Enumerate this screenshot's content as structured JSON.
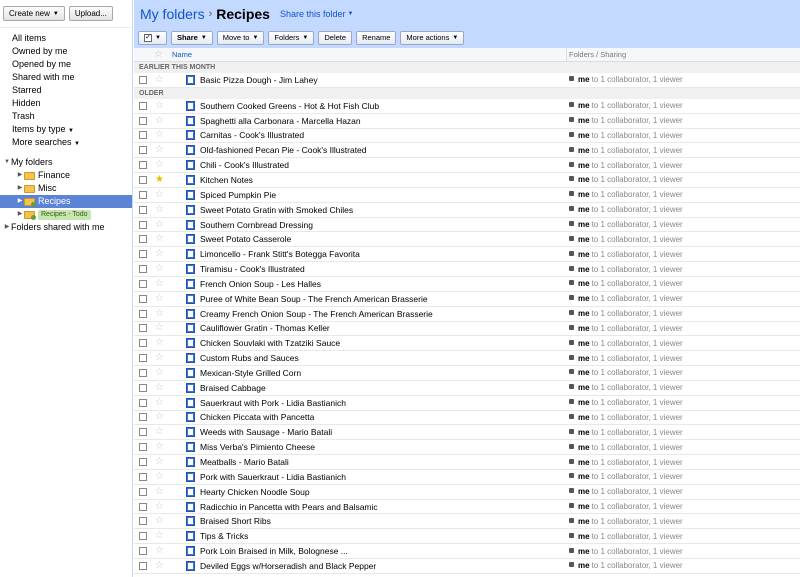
{
  "left": {
    "create_new": "Create new",
    "upload": "Upload...",
    "nav": [
      "All items",
      "Owned by me",
      "Opened by me",
      "Shared with me",
      "Starred",
      "Hidden",
      "Trash",
      "Items by type",
      "More searches"
    ],
    "my_folders": "My folders",
    "folders": [
      {
        "label": "Finance"
      },
      {
        "label": "Misc"
      },
      {
        "label": "Recipes"
      },
      {
        "label": "Recipes - Todo"
      }
    ],
    "shared_folders": "Folders shared with me"
  },
  "header": {
    "root": "My folders",
    "sep": "›",
    "current": "Recipes",
    "share_folder": "Share this folder"
  },
  "toolbar": {
    "share": "Share",
    "move_to": "Move to",
    "folders": "Folders",
    "delete": "Delete",
    "rename": "Rename",
    "more_actions": "More actions"
  },
  "columns": {
    "name": "Name",
    "folders_sharing": "Folders / Sharing"
  },
  "groups": {
    "earlier": "EARLIER THIS MONTH",
    "older": "OLDER"
  },
  "sharing": {
    "owner": "me",
    "rest": "to 1 collaborator, 1 viewer"
  },
  "rows_earlier": [
    {
      "title": "Basic Pizza Dough - Jim Lahey",
      "starred": false
    }
  ],
  "rows_older": [
    {
      "title": "Southern Cooked Greens - Hot & Hot Fish Club",
      "starred": false
    },
    {
      "title": "Spaghetti alla Carbonara - Marcella Hazan",
      "starred": false
    },
    {
      "title": "Carnitas - Cook's Illustrated",
      "starred": false
    },
    {
      "title": "Old-fashioned Pecan Pie - Cook's Illustrated",
      "starred": false
    },
    {
      "title": "Chili - Cook's Illustrated",
      "starred": false
    },
    {
      "title": "Kitchen Notes",
      "starred": true
    },
    {
      "title": "Spiced Pumpkin Pie",
      "starred": false
    },
    {
      "title": "Sweet Potato Gratin with Smoked Chiles",
      "starred": false
    },
    {
      "title": "Southern Cornbread Dressing",
      "starred": false
    },
    {
      "title": "Sweet Potato Casserole",
      "starred": false
    },
    {
      "title": "Limoncello - Frank Stitt's Botegga Favorita",
      "starred": false
    },
    {
      "title": "Tiramisu - Cook's Illustrated",
      "starred": false
    },
    {
      "title": "French Onion Soup - Les Halles",
      "starred": false
    },
    {
      "title": "Puree of White Bean Soup - The French American Brasserie",
      "starred": false
    },
    {
      "title": "Creamy French Onion Soup - The French American Brasserie",
      "starred": false
    },
    {
      "title": "Cauliflower Gratin - Thomas Keller",
      "starred": false
    },
    {
      "title": "Chicken Souvlaki with Tzatziki Sauce",
      "starred": false
    },
    {
      "title": "Custom Rubs and Sauces",
      "starred": false
    },
    {
      "title": "Mexican-Style Grilled Corn",
      "starred": false
    },
    {
      "title": "Braised Cabbage",
      "starred": false
    },
    {
      "title": "Sauerkraut with Pork - Lidia Bastianich",
      "starred": false
    },
    {
      "title": "Chicken Piccata with Pancetta",
      "starred": false
    },
    {
      "title": "Weeds with Sausage - Mario Batali",
      "starred": false
    },
    {
      "title": "Miss Verba's Pimiento Cheese",
      "starred": false
    },
    {
      "title": "Meatballs - Mario Batali",
      "starred": false
    },
    {
      "title": "Pork with Sauerkraut - Lidia Bastianich",
      "starred": false
    },
    {
      "title": "Hearty Chicken Noodle Soup",
      "starred": false
    },
    {
      "title": "Radicchio in Pancetta with Pears and Balsamic",
      "starred": false
    },
    {
      "title": "Braised Short Ribs",
      "starred": false
    },
    {
      "title": "Tips & Tricks",
      "starred": false
    },
    {
      "title": "Pork Loin Braised in Milk, Bolognese ...",
      "starred": false
    },
    {
      "title": "Deviled Eggs w/Horseradish and Black Pepper",
      "starred": false
    }
  ],
  "colors": {
    "header_bg": "#c3d9ff",
    "link": "#1155cc",
    "selected_folder": "#5b84d6"
  }
}
